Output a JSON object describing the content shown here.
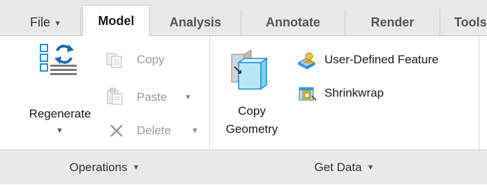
{
  "tabs": {
    "file": "File",
    "model": "Model",
    "analysis": "Analysis",
    "annotate": "Annotate",
    "render": "Render",
    "tools": "Tools"
  },
  "operations": {
    "regenerate": "Regenerate",
    "copy": "Copy",
    "paste": "Paste",
    "delete": "Delete",
    "group_label": "Operations"
  },
  "get_data": {
    "copy_geometry_line1": "Copy",
    "copy_geometry_line2": "Geometry",
    "user_defined_feature": "User-Defined Feature",
    "shrinkwrap": "Shrinkwrap",
    "group_label": "Get Data"
  },
  "colors": {
    "accent_blue": "#1f8fd6",
    "disabled_text": "#9a9a9a",
    "tab_bar": "#e8e8e8"
  }
}
